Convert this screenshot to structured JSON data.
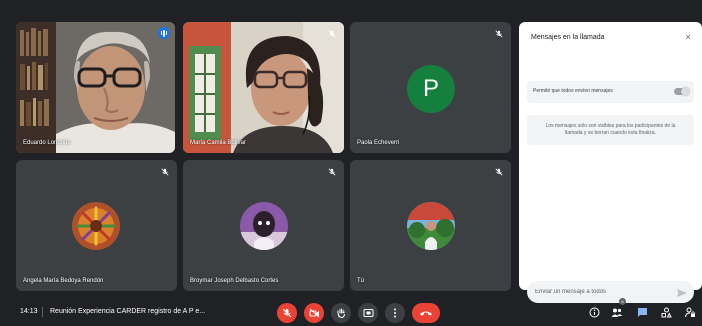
{
  "participants": [
    {
      "name": "Eduardo Londoño",
      "speaking": true
    },
    {
      "name": "María Camila Bolívar",
      "mic_off": true
    },
    {
      "name": "Paola Echeverri",
      "initial": "P",
      "avatar_color": "#15803d",
      "mic_off": true
    },
    {
      "name": "Angela María Bedoya Rendón",
      "mic_off": true
    },
    {
      "name": "Broymar Joseph Delbasto Cortes",
      "mic_off": true
    },
    {
      "name": "Tú",
      "mic_off": true
    }
  ],
  "chat_panel": {
    "title": "Mensajes en la llamada",
    "close_label": "×",
    "toggle_label": "Permitir que todos envíen mensajes",
    "toggle_on": true,
    "info_text": "Los mensajes solo son visibles para los participantes de la llamada y se borran cuando esta finaliza.",
    "input_placeholder": "Enviar un mensaje a todos"
  },
  "bottom_bar": {
    "time": "14:13",
    "meeting_title": "Reunión Experiencia CARDER registro de A P e...",
    "participant_count": "6"
  },
  "colors": {
    "background": "#202124",
    "tile": "#3c4043",
    "active_outline": "#8ab4f8",
    "danger": "#ea4335",
    "accent": "#1a73e8"
  }
}
